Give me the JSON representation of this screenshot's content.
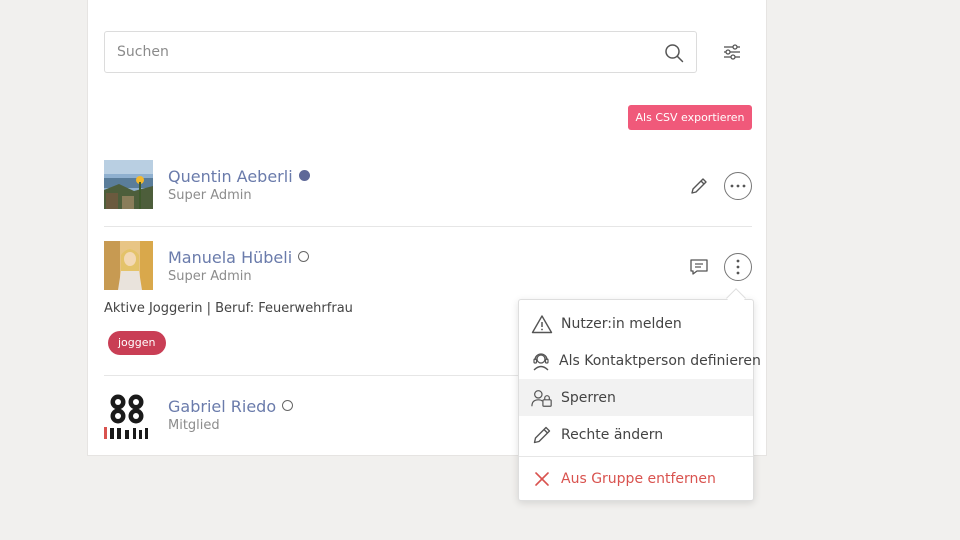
{
  "search": {
    "placeholder": "Suchen"
  },
  "toolbar": {
    "export_csv_label": "Als CSV exportieren"
  },
  "members": [
    {
      "name": "Quentin Aeberli",
      "role": "Super Admin",
      "status": "online"
    },
    {
      "name": "Manuela Hübeli",
      "role": "Super Admin",
      "status": "offline",
      "bio": "Aktive Joggerin | Beruf: Feuerwehrfrau",
      "tags": [
        "joggen"
      ]
    },
    {
      "name": "Gabriel Riedo",
      "role": "Mitglied",
      "status": "offline"
    }
  ],
  "menu": {
    "report": "Nutzer:in melden",
    "contact": "Als Kontaktperson definieren",
    "block": "Sperren",
    "rights": "Rechte ändern",
    "remove": "Aus Gruppe entfernen"
  },
  "colors": {
    "accent": "#f0597a",
    "name": "#6a7bab",
    "tag": "#c93e55",
    "online": "#5e6898",
    "danger": "#d9534f"
  },
  "icons": [
    "search-icon",
    "filter-sliders-icon",
    "pencil-icon",
    "more-horizontal-icon",
    "chat-icon",
    "more-vertical-icon",
    "warning-icon",
    "headset-icon",
    "user-lock-icon",
    "close-icon"
  ]
}
